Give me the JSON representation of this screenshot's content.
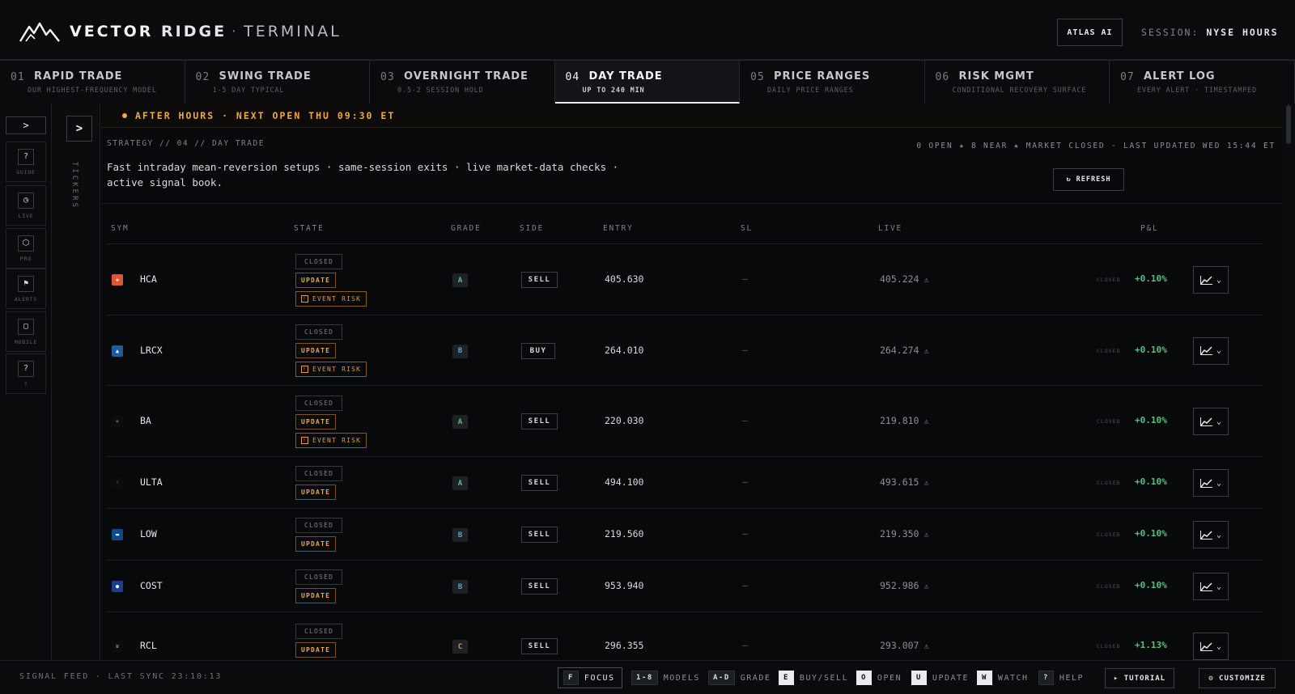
{
  "header": {
    "brand_1": "VECTOR",
    "brand_2": "RIDGE",
    "brand_sep": "·",
    "brand_3": "TERMINAL",
    "atlas_label": "ATLAS AI",
    "session_label": "SESSION:",
    "session_value": "NYSE HOURS"
  },
  "tabs": [
    {
      "num": "01",
      "title": "RAPID TRADE",
      "sub": "OUR HIGHEST-FREQUENCY MODEL"
    },
    {
      "num": "02",
      "title": "SWING TRADE",
      "sub": "1-5 DAY TYPICAL"
    },
    {
      "num": "03",
      "title": "OVERNIGHT TRADE",
      "sub": "0.5-2 SESSION HOLD"
    },
    {
      "num": "04",
      "title": "DAY TRADE",
      "sub": "UP TO 240 MIN"
    },
    {
      "num": "05",
      "title": "PRICE RANGES",
      "sub": "DAILY PRICE RANGES"
    },
    {
      "num": "06",
      "title": "RISK MGMT",
      "sub": "CONDITIONAL RECOVERY SURFACE"
    },
    {
      "num": "07",
      "title": "ALERT LOG",
      "sub": "EVERY ALERT · TIMESTAMPED"
    }
  ],
  "rail": {
    "toggle": ">",
    "items": [
      {
        "icon": "?",
        "label": "GUIDE"
      },
      {
        "icon": "◷",
        "label": "LIVE"
      },
      {
        "icon": "⬡",
        "label": "PRO"
      },
      {
        "icon": "⚑",
        "label": "ALERTS"
      },
      {
        "icon": "▢",
        "label": "MOBILE"
      },
      {
        "icon": "?",
        "label": "?"
      }
    ]
  },
  "tickers_panel": {
    "toggle": ">",
    "label": "TICKERS"
  },
  "banner": "AFTER HOURS · NEXT OPEN THU 09:30 ET",
  "strategy": {
    "crumb": "STRATEGY // 04 // DAY TRADE",
    "description": "Fast intraday mean-reversion setups · same-session exits · live market-data checks · active signal book.",
    "status": "0 OPEN ★ 8 NEAR ★ MARKET CLOSED - LAST UPDATED WED 15:44 ET",
    "refresh_label": "REFRESH"
  },
  "table": {
    "headers": {
      "sym": "SYM",
      "state": "STATE",
      "grade": "GRADE",
      "side": "SIDE",
      "entry": "ENTRY",
      "sl": "SL",
      "live": "LIVE",
      "pnl": "P&L"
    },
    "labels": {
      "closed": "CLOSED",
      "update": "UPDATE",
      "event_risk": "EVENT RISK",
      "closed_tag": "CLOSED",
      "dash": "—"
    },
    "rows": [
      {
        "sym": "HCA",
        "logo_color": "#e2552f",
        "logo_glyph": "✚",
        "event": true,
        "grade": "A",
        "side": "SELL",
        "entry": "405.630",
        "live": "405.224",
        "pnl": "+0.10%"
      },
      {
        "sym": "LRCX",
        "logo_color": "#1e5b9a",
        "logo_glyph": "▲",
        "event": true,
        "grade": "B",
        "side": "BUY",
        "entry": "264.010",
        "live": "264.274",
        "pnl": "+0.10%"
      },
      {
        "sym": "BA",
        "logo_color": "#0b0c0e",
        "logo_glyph": "✈",
        "event": true,
        "grade": "A",
        "side": "SELL",
        "entry": "220.030",
        "live": "219.810",
        "pnl": "+0.10%"
      },
      {
        "sym": "ULTA",
        "logo_color": "#0b0c0e",
        "logo_glyph": "◦",
        "event": false,
        "grade": "A",
        "side": "SELL",
        "entry": "494.100",
        "live": "493.615",
        "pnl": "+0.10%"
      },
      {
        "sym": "LOW",
        "logo_color": "#0d4a8a",
        "logo_glyph": "▬",
        "event": false,
        "grade": "B",
        "side": "SELL",
        "entry": "219.560",
        "live": "219.350",
        "pnl": "+0.10%"
      },
      {
        "sym": "COST",
        "logo_color": "#1b3f8c",
        "logo_glyph": "●",
        "event": false,
        "grade": "B",
        "side": "SELL",
        "entry": "953.940",
        "live": "952.986",
        "pnl": "+0.10%"
      },
      {
        "sym": "RCL",
        "logo_color": "#0b0c0e",
        "logo_glyph": "♛",
        "event": false,
        "grade": "C",
        "side": "SELL",
        "entry": "296.355",
        "live": "293.007",
        "pnl": "+1.13%"
      }
    ]
  },
  "footer": {
    "feed": "SIGNAL FEED · LAST SYNC 23:10:13",
    "shortcuts": [
      {
        "key": "F",
        "label": "FOCUS"
      },
      {
        "key": "1-8",
        "label": "MODELS"
      },
      {
        "key": "A-D",
        "label": "GRADE"
      },
      {
        "key": "E",
        "label": "BUY/SELL"
      },
      {
        "key": "O",
        "label": "OPEN"
      },
      {
        "key": "U",
        "label": "UPDATE"
      },
      {
        "key": "W",
        "label": "WATCH"
      },
      {
        "key": "?",
        "label": "HELP"
      }
    ],
    "tutorial_label": "▸ TUTORIAL",
    "customize_label": "⚙ CUSTOMIZE"
  },
  "colors": {
    "accent_amber": "#f0a93a",
    "positive_green": "#55c27a",
    "grade_blue": "#4ba3d6",
    "background": "#08090b"
  }
}
